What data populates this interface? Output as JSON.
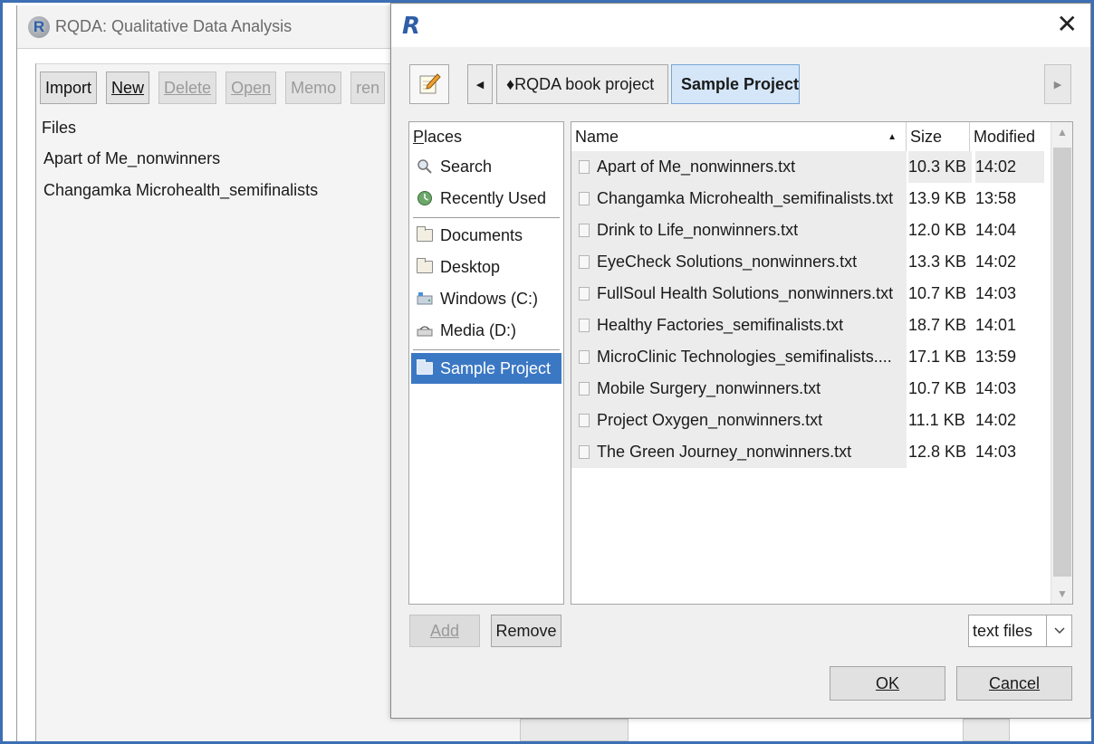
{
  "main_window": {
    "title": "RQDA: Qualitative Data Analysis",
    "toolbar": {
      "import": "Import",
      "new": "New",
      "delete": "Delete",
      "open": "Open",
      "memo": "Memo",
      "rename_partial": "ren"
    },
    "files_label": "Files",
    "files": [
      "Apart of Me_nonwinners",
      "Changamka Microhealth_semifinalists"
    ]
  },
  "dialog": {
    "title_icon": "R",
    "close_glyph": "✕",
    "path": [
      "♦RQDA book project",
      "Sample Project"
    ],
    "places": {
      "header_prefix": "P",
      "header_rest": "laces",
      "items": [
        {
          "label": "Search",
          "icon": "search-icon"
        },
        {
          "label": "Recently Used",
          "icon": "clock-icon"
        },
        {
          "label": "Documents",
          "icon": "folder-icon"
        },
        {
          "label": "Desktop",
          "icon": "folder-icon"
        },
        {
          "label": "Windows (C:)",
          "icon": "drive-icon"
        },
        {
          "label": "Media (D:)",
          "icon": "drive-icon"
        },
        {
          "label": "Sample Project",
          "icon": "folder-icon",
          "selected": true
        }
      ]
    },
    "columns": {
      "name": "Name",
      "size": "Size",
      "modified": "Modified"
    },
    "files": [
      {
        "name": "Apart of Me_nonwinners.txt",
        "size": "10.3 KB",
        "modified": "14:02"
      },
      {
        "name": "Changamka Microhealth_semifinalists.txt",
        "size": "13.9 KB",
        "modified": "13:58"
      },
      {
        "name": "Drink to Life_nonwinners.txt",
        "size": "12.0 KB",
        "modified": "14:04"
      },
      {
        "name": "EyeCheck Solutions_nonwinners.txt",
        "size": "13.3 KB",
        "modified": "14:02"
      },
      {
        "name": "FullSoul Health Solutions_nonwinners.txt",
        "size": "10.7 KB",
        "modified": "14:03"
      },
      {
        "name": "Healthy Factories_semifinalists.txt",
        "size": "18.7 KB",
        "modified": "14:01"
      },
      {
        "name": "MicroClinic Technologies_semifinalists....",
        "size": "17.1 KB",
        "modified": "13:59"
      },
      {
        "name": "Mobile Surgery_nonwinners.txt",
        "size": "10.7 KB",
        "modified": "14:03"
      },
      {
        "name": "Project Oxygen_nonwinners.txt",
        "size": "11.1 KB",
        "modified": "14:02"
      },
      {
        "name": "The Green Journey_nonwinners.txt",
        "size": "12.8 KB",
        "modified": "14:03"
      }
    ],
    "buttons": {
      "add": "Add",
      "remove": "Remove",
      "ok": "OK",
      "cancel": "Cancel"
    },
    "filter": "text files"
  },
  "colors": {
    "accent_border": "#3c6fb3",
    "selection": "#3b78c4",
    "breadcrumb_active": "#d4e6f8"
  }
}
